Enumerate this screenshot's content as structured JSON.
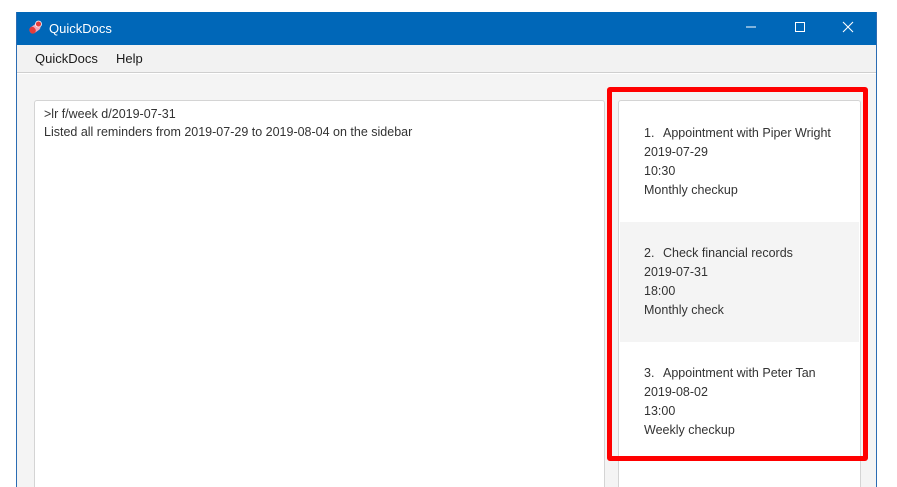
{
  "window": {
    "title": "QuickDocs",
    "controls": {
      "minimize": "minimize",
      "maximize": "maximize",
      "close": "close"
    }
  },
  "menu": {
    "items": [
      {
        "label": "QuickDocs"
      },
      {
        "label": "Help"
      }
    ]
  },
  "command": {
    "input": ">lr f/week d/2019-07-31",
    "result": "Listed all reminders from 2019-07-29 to 2019-08-04 on the sidebar"
  },
  "sidebar": {
    "reminders": [
      {
        "index": "1.",
        "title": "Appointment with Piper Wright",
        "date": "2019-07-29",
        "time": "10:30",
        "description": "Monthly checkup"
      },
      {
        "index": "2.",
        "title": "Check financial records",
        "date": "2019-07-31",
        "time": "18:00",
        "description": "Monthly check"
      },
      {
        "index": "3.",
        "title": "Appointment with Peter Tan",
        "date": "2019-08-02",
        "time": "13:00",
        "description": "Weekly checkup"
      }
    ]
  },
  "colors": {
    "titlebar": "#0067b8",
    "highlight": "#ff0000",
    "alt_row": "#f4f4f4"
  },
  "icons": [
    "app-icon",
    "minimize-icon",
    "maximize-icon",
    "close-icon"
  ]
}
